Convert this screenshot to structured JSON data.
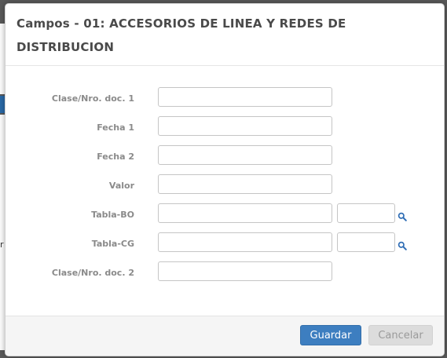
{
  "modal": {
    "title": "Campos - 01: ACCESORIOS DE LINEA Y REDES DE DISTRIBUCION",
    "fields": [
      {
        "label": "Clase/Nro. doc. 1",
        "value": ""
      },
      {
        "label": "Fecha 1",
        "value": ""
      },
      {
        "label": "Fecha 2",
        "value": ""
      },
      {
        "label": "Valor",
        "value": ""
      },
      {
        "label": "Tabla-BO",
        "value": "",
        "secondary_value": ""
      },
      {
        "label": "Tabla-CG",
        "value": "",
        "secondary_value": ""
      },
      {
        "label": "Clase/Nro. doc. 2",
        "value": ""
      }
    ],
    "icons": {
      "lookup": "search-icon"
    },
    "footer": {
      "save_label": "Guardar",
      "cancel_label": "Cancelar"
    }
  },
  "background": {
    "partial_text": "r"
  },
  "colors": {
    "primary_button": "#3d7ec0",
    "disabled_button": "#dcdcdc",
    "overlay": "#5a5a5a"
  }
}
